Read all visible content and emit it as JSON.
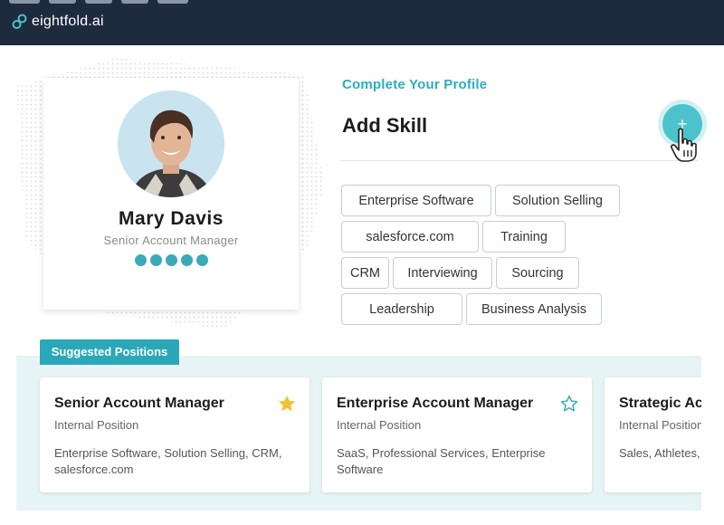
{
  "app": {
    "logo_text": "eightfold.ai"
  },
  "profile": {
    "name": "Mary Davis",
    "title": "Senior Account Manager",
    "rating": 5
  },
  "skills_section": {
    "eyebrow": "Complete Your Profile",
    "title": "Add Skill",
    "add_button": "+",
    "chips": [
      [
        "Enterprise Software",
        "Solution Selling"
      ],
      [
        "salesforce.com",
        "Training"
      ],
      [
        "CRM",
        "Interviewing",
        "Sourcing"
      ],
      [
        "Leadership",
        "Business Analysis"
      ]
    ]
  },
  "suggested": {
    "tab_label": "Suggested Positions",
    "cards": [
      {
        "title": "Senior Account Manager",
        "type": "Internal Position",
        "skills": "Enterprise Software, Solution Selling, CRM, salesforce.com",
        "starred": true
      },
      {
        "title": "Enterprise Account Manager",
        "type": "Internal Position",
        "skills": "SaaS, Professional Services, Enterprise Software",
        "starred": false
      },
      {
        "title": "Strategic Account Manager",
        "type": "Internal Position",
        "skills": "Sales, Athletes, Media",
        "starred": false
      }
    ]
  },
  "colors": {
    "header": "#1e2a3d",
    "accent": "#2aaebe",
    "star_filled": "#f2c12e",
    "star_outline": "#3aaab9"
  }
}
